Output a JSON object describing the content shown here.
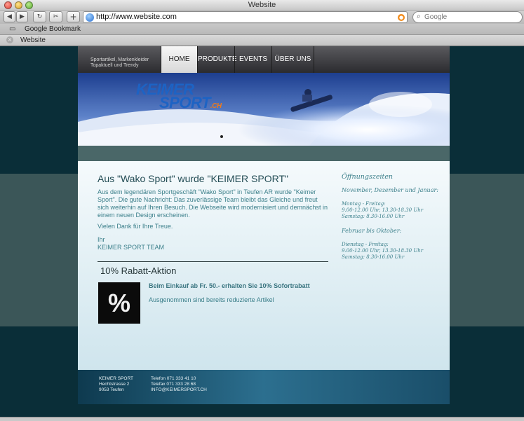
{
  "window": {
    "title": "Website"
  },
  "toolbar": {
    "back_icon": "◀",
    "forward_icon": "▶",
    "reload_icon": "↻",
    "bookmarks_icon": "✂",
    "add_icon": "+",
    "url": "http://www.website.com",
    "search_placeholder": "Google"
  },
  "bookmarks": {
    "items": [
      {
        "label": "Google Bookmark"
      }
    ]
  },
  "tabs": [
    {
      "label": "Website"
    }
  ],
  "site": {
    "tagline_line1": "Sportartikel, Markenkleider",
    "tagline_line2": "Topaktuell und Trendy",
    "nav": {
      "home": "HOME",
      "produkte": "PRODUKTE",
      "events": "EVENTS",
      "ueber_uns": "ÜBER UNS"
    },
    "logo_line1": "KEIMER",
    "logo_line2": "SPORT",
    "logo_suffix": ".CH",
    "heading": "Aus \"Wako Sport\" wurde \"KEIMER SPORT\"",
    "intro": "Aus dem legendären Sportgeschäft \"Wako Sport\" in Teufen AR wurde \"Keimer Sport\". Die gute Nachricht: Das zuverlässige Team bleibt das Gleiche und freut sich weiterhin auf Ihren Besuch. Die Webseite wird modernisiert und demnächst in einem neuen Design erscheinen.",
    "thanks": "Vielen Dank für Ihre Treue.",
    "sign_line1": "Ihr",
    "sign_line2": "KEIMER SPORT TEAM",
    "promo_heading": "10% Rabatt-Aktion",
    "promo_icon": "%",
    "promo_offer": "Beim Einkauf ab Fr. 50.- erhalten Sie 10% Sofortrabatt",
    "promo_note": "Ausgenommen sind bereits reduzierte Artikel",
    "hours": {
      "title": "Öffnungszeiten",
      "season1": "November, Dezember und Januar:",
      "s1_line1": "Montag - Freitag:",
      "s1_line2": "9.00-12.00 Uhr, 13.30-18.30 Uhr",
      "s1_line3": "Samstag: 8.30-16.00 Uhr",
      "season2": "Februar bis Oktober:",
      "s2_line1": "Dienstag - Freitag:",
      "s2_line2": "9.00-12.00 Uhr, 13.30-18.30 Uhr",
      "s2_line3": "Samstag: 8.30-16.00 Uhr"
    },
    "footer": {
      "name": "KEIMER SPORT",
      "street": "Hechtstrasse 2",
      "city": "9053 Teufen",
      "phone": "Telefon 071 333 41 10",
      "fax": "Telefax 071 333 28 68",
      "email": "INFO@KEIMERSPORT.CH"
    }
  },
  "colors": {
    "brand_blue": "#1d63c4",
    "brand_orange": "#f07a1a",
    "text_teal": "#3b7f8a",
    "page_bg": "#0a2e38"
  }
}
